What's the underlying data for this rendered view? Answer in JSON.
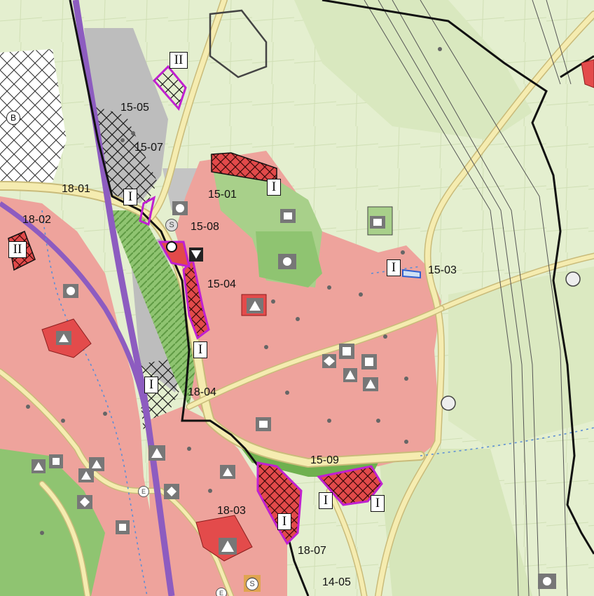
{
  "map": {
    "colors": {
      "background": "#e4efcf",
      "built_up_area": "#eea39c",
      "built_up_dark": "#e47f77",
      "industrial_area": "#bdbdbd",
      "green_space": "#8fc471",
      "pale_green_fields": "#d2e4b4",
      "roads": "#f5ecb0",
      "road_outline": "#c9bb7a",
      "railway": "#8d5cc0",
      "planned_area_outline": "#c020d0",
      "boundary_line": "#111111",
      "water_lines": "#5b8ed6",
      "building_highlight": "#e34b4b",
      "hatch_red": "#e24a4a"
    },
    "area_labels": [
      {
        "id": "15-05",
        "text": "15-05"
      },
      {
        "id": "15-07",
        "text": "15-07"
      },
      {
        "id": "18-01",
        "text": "18-01"
      },
      {
        "id": "18-02",
        "text": "18-02"
      },
      {
        "id": "15-01",
        "text": "15-01"
      },
      {
        "id": "15-08",
        "text": "15-08"
      },
      {
        "id": "15-04",
        "text": "15-04"
      },
      {
        "id": "15-03",
        "text": "15-03"
      },
      {
        "id": "18-04",
        "text": "18-04"
      },
      {
        "id": "15-09",
        "text": "15-09"
      },
      {
        "id": "18-03",
        "text": "18-03"
      },
      {
        "id": "18-07",
        "text": "18-07"
      },
      {
        "id": "14-05",
        "text": "14-05"
      }
    ],
    "category_markers": [
      {
        "id": "m1",
        "text": "II"
      },
      {
        "id": "m2",
        "text": "I"
      },
      {
        "id": "m3",
        "text": "I"
      },
      {
        "id": "m4",
        "text": "II"
      },
      {
        "id": "m5",
        "text": "I"
      },
      {
        "id": "m6",
        "text": "I"
      },
      {
        "id": "m7",
        "text": "I"
      },
      {
        "id": "m8",
        "text": "I"
      },
      {
        "id": "m9",
        "text": "I"
      },
      {
        "id": "m10",
        "text": "I"
      }
    ],
    "symbols": {
      "circle_b": "B",
      "circle_s": "S",
      "circle_e": "E"
    }
  }
}
